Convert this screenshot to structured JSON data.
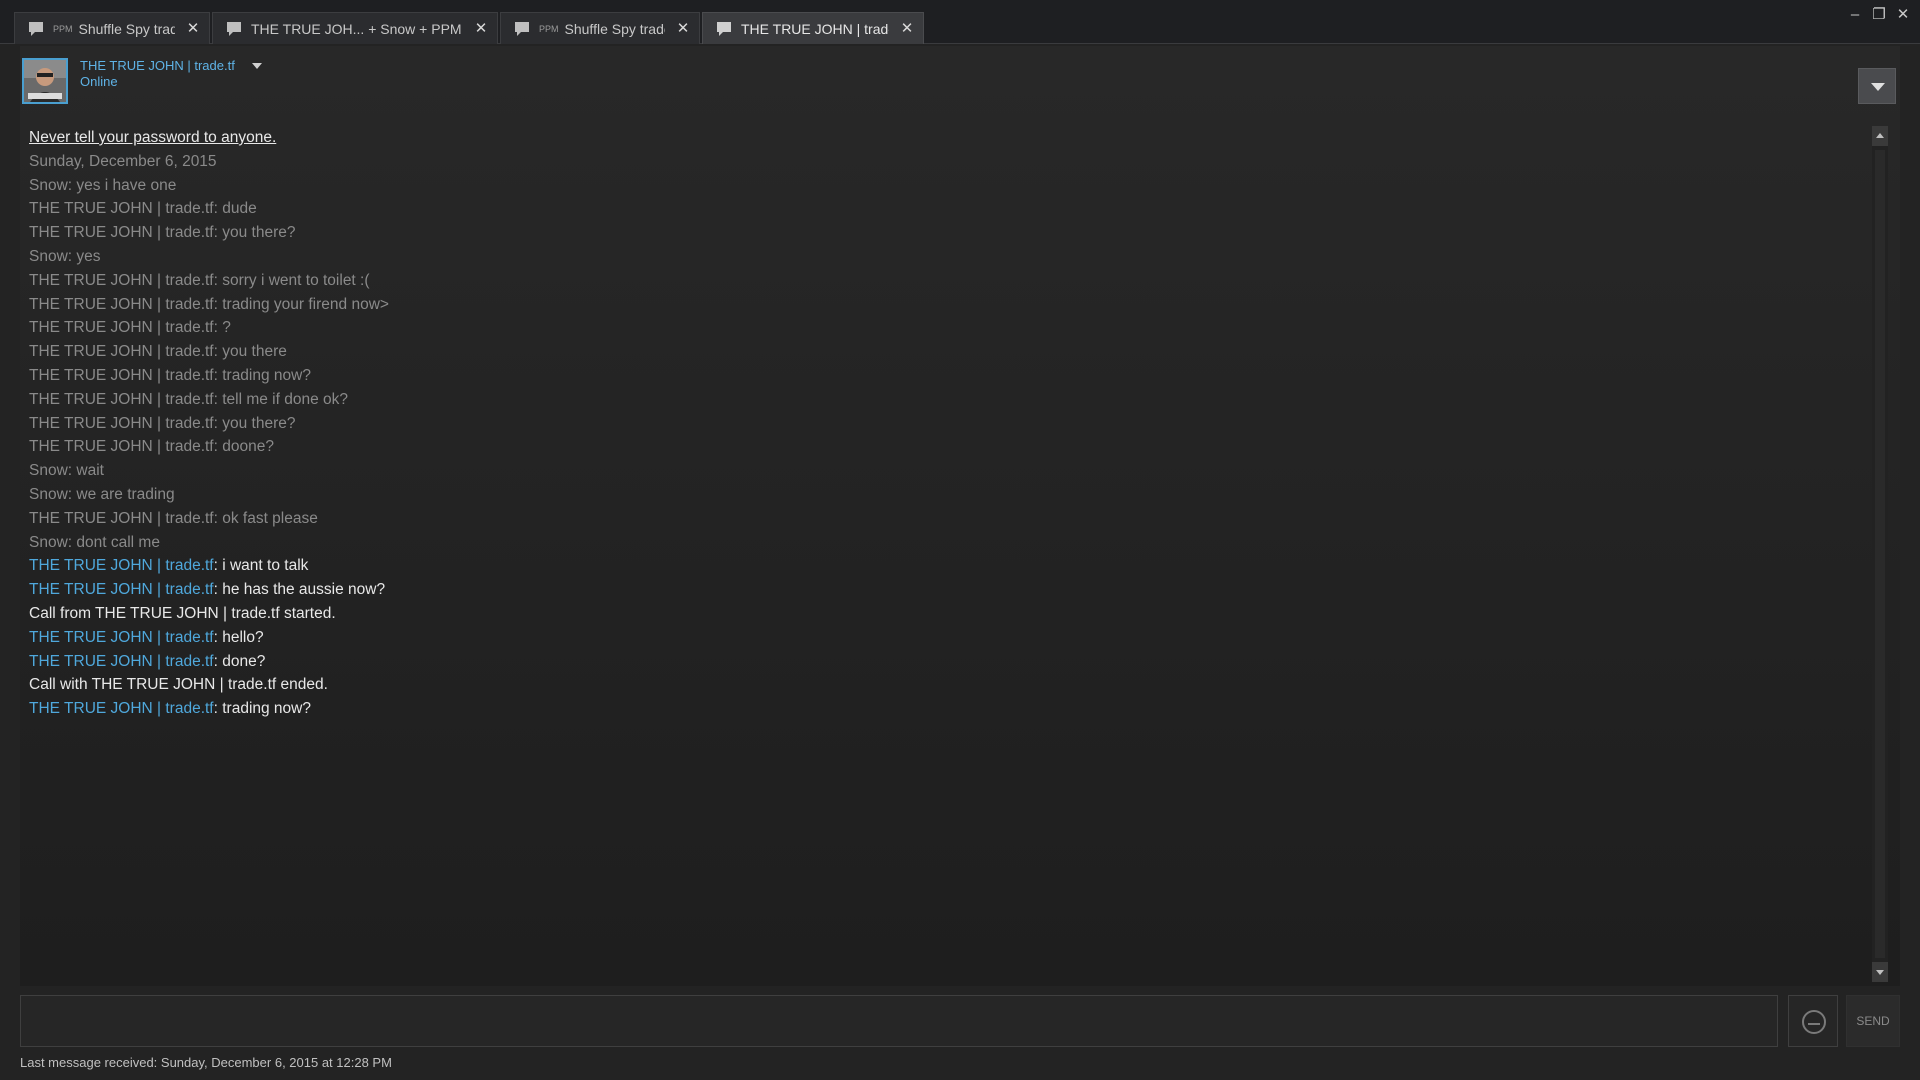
{
  "tabs": [
    {
      "ppm": "PPM",
      "title": "Shuffle Spy trade.tf",
      "active": false
    },
    {
      "ppm": "",
      "title": "THE TRUE JOH... + Snow + PPM Sh...",
      "active": false
    },
    {
      "ppm": "PPM",
      "title": "Shuffle Spy trade.tf",
      "active": false
    },
    {
      "ppm": "",
      "title": "THE TRUE JOHN | trade.tf",
      "active": true
    }
  ],
  "window_controls": {
    "minimize": "–",
    "restore": "❐",
    "close": "✕"
  },
  "header": {
    "friend_name": "THE TRUE JOHN | trade.tf",
    "status": "Online"
  },
  "log": {
    "notice": "Never tell your password to anyone.",
    "date": "Sunday, December 6, 2015",
    "old_lines": [
      "Snow: yes i have one",
      "THE TRUE JOHN | trade.tf: dude",
      "THE TRUE JOHN | trade.tf: you there?",
      "Snow: yes",
      "THE TRUE JOHN | trade.tf: sorry i went to toilet :(",
      "THE TRUE JOHN | trade.tf: trading your firend now>",
      "THE TRUE JOHN | trade.tf: ?",
      "THE TRUE JOHN | trade.tf: you there",
      "THE TRUE JOHN | trade.tf: trading now?",
      "THE TRUE JOHN | trade.tf: tell me if done ok?",
      "THE TRUE JOHN | trade.tf: you there?",
      "THE TRUE JOHN | trade.tf: doone?",
      "Snow: wait",
      "Snow: we are trading",
      "THE TRUE JOHN | trade.tf: ok fast please",
      "Snow: dont call me"
    ],
    "new_1": {
      "who": "THE TRUE JOHN | trade.tf",
      "msg": "i want to talk"
    },
    "new_2": {
      "who": "THE TRUE JOHN | trade.tf",
      "msg": "he has the aussie now?"
    },
    "call_started": "Call from THE TRUE JOHN | trade.tf started.",
    "new_3": {
      "who": "THE TRUE JOHN | trade.tf",
      "msg": "hello?"
    },
    "new_4": {
      "who": "THE TRUE JOHN | trade.tf",
      "msg": "done?"
    },
    "call_ended": "Call with THE TRUE JOHN | trade.tf ended.",
    "new_5": {
      "who": "THE TRUE JOHN | trade.tf",
      "msg": "trading now?"
    },
    "separator": ": "
  },
  "input": {
    "value": "",
    "placeholder": ""
  },
  "send_label": "SEND",
  "footer": "Last message received: Sunday, December 6, 2015 at 12:28 PM",
  "colors": {
    "accent": "#4fa8dc",
    "background": "#232323"
  }
}
